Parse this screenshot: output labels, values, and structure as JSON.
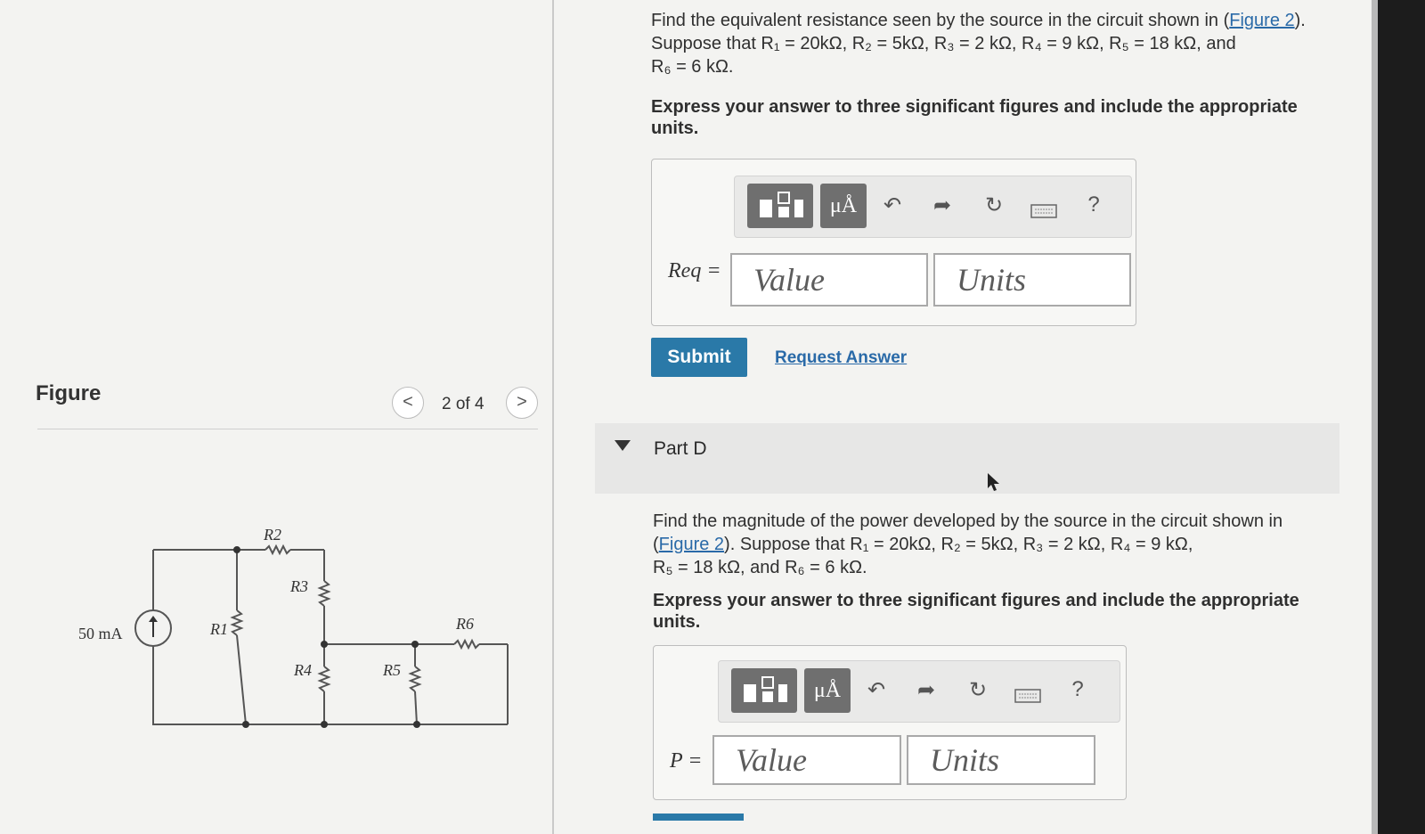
{
  "figure": {
    "title": "Figure",
    "counter": "2 of 4",
    "prev_symbol": "<",
    "next_symbol": ">",
    "circuit": {
      "source_label": "50 mA",
      "r1": "R1",
      "r2": "R2",
      "r3": "R3",
      "r4": "R4",
      "r5": "R5",
      "r6": "R6"
    }
  },
  "partC": {
    "q_line1_a": "Find the equivalent resistance seen by the source in the circuit shown in (",
    "q_link": "Figure 2",
    "q_line1_b": ").",
    "q_line2": "Suppose that R₁ = 20kΩ, R₂ = 5kΩ, R₃ = 2 kΩ, R₄ = 9 kΩ, R₅ = 18 kΩ, and",
    "q_line3": "R₆ = 6 kΩ.",
    "instruction": "Express your answer to three significant figures and include the appropriate units.",
    "var_label": "Req =",
    "value_placeholder": "Value",
    "units_placeholder": "Units",
    "submit": "Submit",
    "request": "Request Answer"
  },
  "partD": {
    "label": "Part D",
    "q_line1": "Find the magnitude of the power developed by the source in the circuit shown in",
    "q_link": "Figure 2",
    "q_line2_b": "). Suppose that R₁ = 20kΩ, R₂ = 5kΩ, R₃ = 2 kΩ, R₄ = 9 kΩ,",
    "q_line3": "R₅ = 18 kΩ, and R₆ = 6 kΩ.",
    "instruction": "Express your answer to three significant figures and include the appropriate units.",
    "var_label": "P =",
    "value_placeholder": "Value",
    "units_placeholder": "Units"
  },
  "toolbar": {
    "units_symbol": "μÅ",
    "help": "?",
    "icons": [
      "templates-icon",
      "units-icon",
      "undo-icon",
      "redo-icon",
      "reset-icon",
      "keyboard-icon",
      "help-icon"
    ]
  },
  "colors": {
    "link": "#2a6aa8",
    "submit_bg": "#2a79a8"
  }
}
